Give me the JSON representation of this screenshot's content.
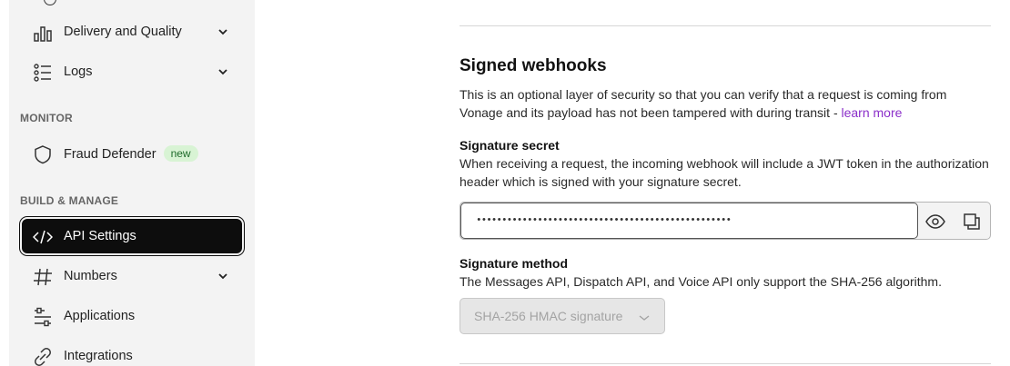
{
  "sidebar": {
    "items": [
      {
        "label": "Delivery and Quality",
        "icon": "bar-chart-icon",
        "expandable": true
      },
      {
        "label": "Logs",
        "icon": "list-icon",
        "expandable": true
      }
    ],
    "monitor_section": "MONITOR",
    "monitor_items": [
      {
        "label": "Fraud Defender",
        "icon": "shield-icon",
        "badge": "new"
      }
    ],
    "build_section": "BUILD & MANAGE",
    "build_items": [
      {
        "label": "API Settings",
        "icon": "code-icon",
        "active": true
      },
      {
        "label": "Numbers",
        "icon": "hash-icon",
        "expandable": true
      },
      {
        "label": "Applications",
        "icon": "applications-icon"
      },
      {
        "label": "Integrations",
        "icon": "link-icon"
      }
    ]
  },
  "main": {
    "title": "Signed webhooks",
    "description": "This is an optional layer of security so that you can verify that a request is coming from Vonage and its payload has not been tampered with during transit - ",
    "learn_more": "learn more",
    "secret": {
      "label": "Signature secret",
      "help": "When receiving a request, the incoming webhook will include a JWT token in the authorization header which is signed with your signature secret.",
      "value": "••••••••••••••••••••••••••••••••••••••••••••••••••"
    },
    "method": {
      "label": "Signature method",
      "help": "The Messages API, Dispatch API, and Voice API only support the SHA-256 algorithm.",
      "selected": "SHA-256 HMAC signature"
    }
  },
  "colors": {
    "sidebar_bg": "#f3f3f3",
    "active_bg": "#0d0d0d",
    "link": "#8b2fc9",
    "badge_bg": "#d8f3d4",
    "badge_text": "#1d6a2a"
  }
}
